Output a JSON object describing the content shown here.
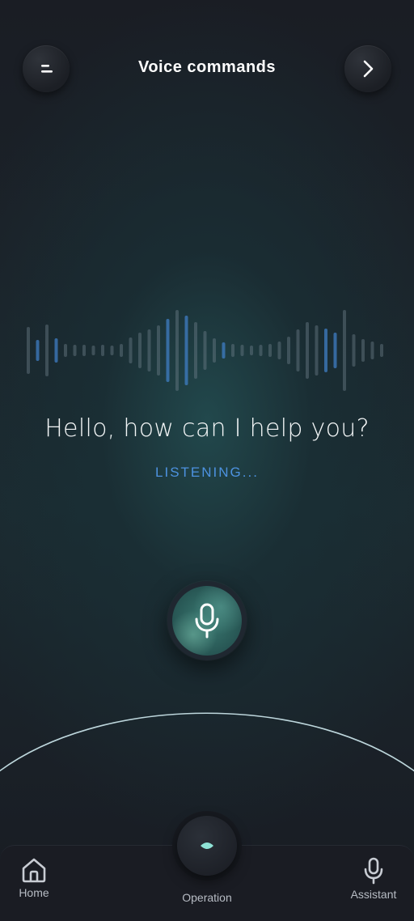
{
  "header": {
    "title": "Voice commands",
    "left_icon": "menu-icon",
    "right_icon": "chevron-right-icon"
  },
  "voice": {
    "greeting": "Hello, how can I help you?",
    "status": "LISTENING...",
    "accent_color": "#4d92e0",
    "mic_icon": "microphone-icon"
  },
  "bottom_nav": {
    "items": [
      {
        "label": "Home",
        "icon": "home-icon"
      },
      {
        "label": "Operation",
        "icon": "eye-icon"
      },
      {
        "label": "Assistant",
        "icon": "microphone-icon"
      }
    ]
  }
}
